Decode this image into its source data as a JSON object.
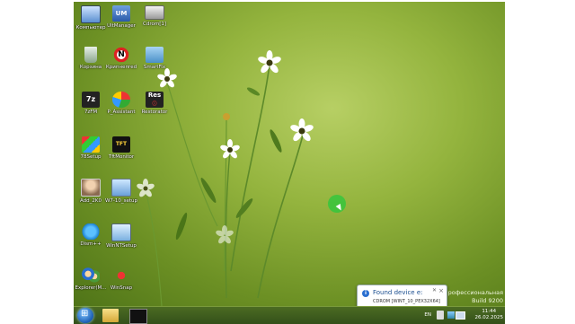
{
  "desktop": {
    "icons": [
      {
        "label": "Компьютер",
        "icon": "computer-icon"
      },
      {
        "label": "UltManager",
        "icon": "manager-icon"
      },
      {
        "label": "Cdrom[1]",
        "icon": "cdrom-icon"
      },
      {
        "label": "Корзина",
        "icon": "recycle-bin-icon"
      },
      {
        "label": "Крипнепred",
        "icon": "no-sign-icon"
      },
      {
        "label": "SmartFix",
        "icon": "folder-icon"
      },
      {
        "label": "7zFM",
        "icon": "7zip-icon"
      },
      {
        "label": "P_Assistant",
        "icon": "partition-icon"
      },
      {
        "label": "Restorator",
        "icon": "resource-icon"
      },
      {
        "label": "78Setup",
        "icon": "setup-icon"
      },
      {
        "label": "TftMonitor",
        "icon": "tft-icon"
      },
      {
        "label": "Add_2K0",
        "icon": "user-icon"
      },
      {
        "label": "W7-10_setup",
        "icon": "install-icon"
      },
      {
        "label": "Dism++",
        "icon": "gears-icon"
      },
      {
        "label": "WinNTSetup",
        "icon": "winnt-icon"
      },
      {
        "label": "Explorer(M...",
        "icon": "explorer-icon"
      },
      {
        "label": "WinSnap",
        "icon": "snap-icon"
      }
    ]
  },
  "notification": {
    "title": "Found device e:",
    "body": "CDROM  [WINT_10_PEX32X64]"
  },
  "watermark": {
    "line1": "Профессиональная",
    "line2": "Build 9200"
  },
  "tray": {
    "lang": "EN",
    "time": "11:44",
    "date": "26.02.2025"
  },
  "colors": {
    "taskbar": "#3e5c1e",
    "desktop": "#94b43e",
    "accent": "#2a6fd0"
  }
}
